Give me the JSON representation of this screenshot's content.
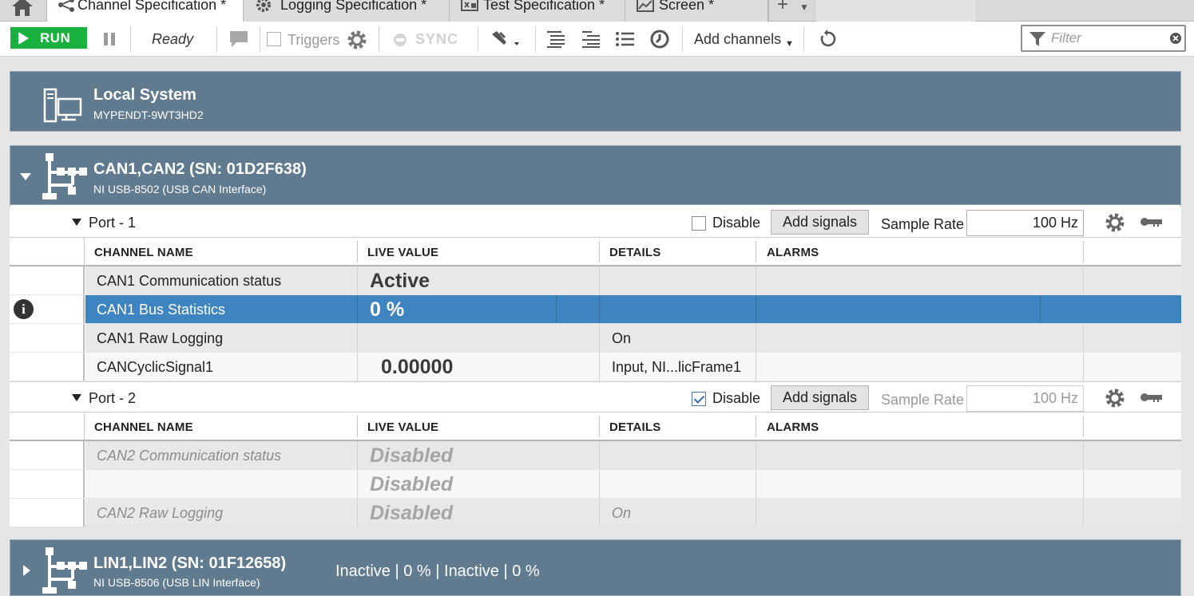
{
  "tabs": [
    {
      "label": "Channel Specification *",
      "icon": "channel-tree-icon",
      "active": true
    },
    {
      "label": "Logging Specification *",
      "icon": "gear-icon",
      "active": false
    },
    {
      "label": "Test Specification *",
      "icon": "test-icon",
      "active": false
    },
    {
      "label": "Screen *",
      "icon": "chart-icon",
      "active": false
    }
  ],
  "toolbar": {
    "run_label": "RUN",
    "status": "Ready",
    "triggers_label": "Triggers",
    "sync_label": "SYNC",
    "add_channels_label": "Add channels",
    "filter_placeholder": "Filter"
  },
  "local_system": {
    "title": "Local System",
    "host": "MYPENDT-9WT3HD2"
  },
  "devices": [
    {
      "title": "CAN1,CAN2 (SN: 01D2F638)",
      "subtitle": "NI USB-8502 (USB CAN Interface)",
      "expanded": true,
      "ports": [
        {
          "label": "Port - 1",
          "disable_label": "Disable",
          "disabled": false,
          "add_signals_label": "Add signals",
          "sample_rate_label": "Sample Rate",
          "sample_rate_value": "100 Hz",
          "columns": [
            "CHANNEL NAME",
            "LIVE VALUE",
            "DETAILS",
            "ALARMS"
          ],
          "rows": [
            {
              "name": "CAN1 Communication status",
              "live": "Active",
              "details": ""
            },
            {
              "name": "CAN1 Bus Statistics",
              "live": "0 %",
              "details": "",
              "selected": true
            },
            {
              "name": "CAN1 Raw Logging",
              "live": "",
              "details": "On"
            },
            {
              "name": "CANCyclicSignal1",
              "live": "0.00000",
              "details": "Input, NI...licFrame1"
            }
          ]
        },
        {
          "label": "Port - 2",
          "disable_label": "Disable",
          "disabled": true,
          "add_signals_label": "Add signals",
          "sample_rate_label": "Sample Rate",
          "sample_rate_value": "100 Hz",
          "columns": [
            "CHANNEL NAME",
            "LIVE VALUE",
            "DETAILS",
            "ALARMS"
          ],
          "rows": [
            {
              "name": "CAN2 Communication status",
              "live": "Disabled",
              "details": ""
            },
            {
              "name": "",
              "live": "Disabled",
              "details": ""
            },
            {
              "name": "CAN2 Raw Logging",
              "live": "Disabled",
              "details": "On"
            }
          ]
        }
      ]
    },
    {
      "title": "LIN1,LIN2 (SN: 01F12658)",
      "subtitle": "NI USB-8506 (USB LIN Interface)",
      "expanded": false,
      "status": "Inactive | 0 % | Inactive | 0 %"
    }
  ],
  "colors": {
    "run_green": "#19b23e",
    "header_slate": "#607a90",
    "selection_blue": "#3d84c0"
  }
}
